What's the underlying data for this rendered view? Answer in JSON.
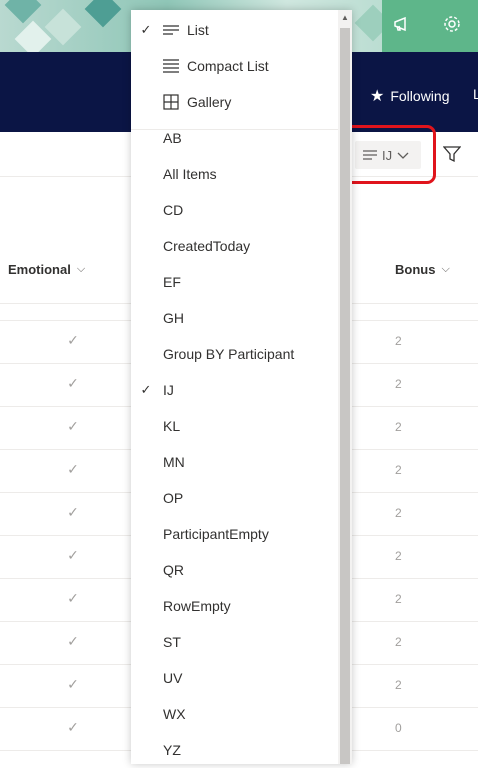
{
  "header": {
    "following_label": "Following",
    "partial_label": "L"
  },
  "colors": {
    "brand_header": "#0b1545",
    "highlight_border": "#e0141c",
    "suite_green": "#5eb68a"
  },
  "icons": {
    "megaphone": "megaphone-icon",
    "settings": "gear-icon",
    "star": "star-icon",
    "filter": "filter-icon",
    "list": "list-icon",
    "compact_list": "compact-list-icon",
    "gallery": "gallery-icon",
    "check": "checkmark-icon"
  },
  "view_switcher": {
    "current_view": "IJ"
  },
  "table": {
    "columns": [
      "Emotional",
      "Bonus"
    ],
    "rows": [
      {
        "emotional": "✓",
        "bonus": "2"
      },
      {
        "emotional": "✓",
        "bonus": "2"
      },
      {
        "emotional": "✓",
        "bonus": "2"
      },
      {
        "emotional": "✓",
        "bonus": "2"
      },
      {
        "emotional": "✓",
        "bonus": "2"
      },
      {
        "emotional": "✓",
        "bonus": "2"
      },
      {
        "emotional": "✓",
        "bonus": "2"
      },
      {
        "emotional": "✓",
        "bonus": "2"
      },
      {
        "emotional": "✓",
        "bonus": "2"
      },
      {
        "emotional": "✓",
        "bonus": "0"
      }
    ]
  },
  "menu": {
    "layout_items": [
      {
        "label": "List",
        "checked": true
      },
      {
        "label": "Compact List",
        "checked": false
      },
      {
        "label": "Gallery",
        "checked": false
      }
    ],
    "views": [
      {
        "label": "AB",
        "checked": false
      },
      {
        "label": "All Items",
        "checked": false
      },
      {
        "label": "CD",
        "checked": false
      },
      {
        "label": "CreatedToday",
        "checked": false
      },
      {
        "label": "EF",
        "checked": false
      },
      {
        "label": "GH",
        "checked": false
      },
      {
        "label": "Group BY Participant",
        "checked": false
      },
      {
        "label": "IJ",
        "checked": true
      },
      {
        "label": "KL",
        "checked": false
      },
      {
        "label": "MN",
        "checked": false
      },
      {
        "label": "OP",
        "checked": false
      },
      {
        "label": "ParticipantEmpty",
        "checked": false
      },
      {
        "label": "QR",
        "checked": false
      },
      {
        "label": "RowEmpty",
        "checked": false
      },
      {
        "label": "ST",
        "checked": false
      },
      {
        "label": "UV",
        "checked": false
      },
      {
        "label": "WX",
        "checked": false
      },
      {
        "label": "YZ",
        "checked": false
      }
    ]
  }
}
